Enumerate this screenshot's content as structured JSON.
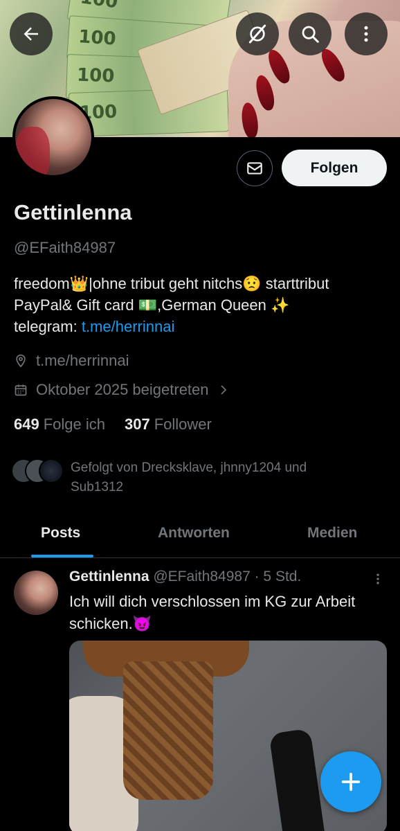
{
  "banner": {
    "note_denomination": "100"
  },
  "profile": {
    "name": "Gettinlenna",
    "handle": "@EFaith84987",
    "follow_label": "Folgen",
    "bio_line1": "freedom👑|ohne tribut geht nitchs😟 starttribut",
    "bio_line2": "PayPal& Gift card 💵,German Queen ✨",
    "bio_line3_prefix": "telegram: ",
    "bio_link": "t.me/herrinnai",
    "location": "t.me/herrinnai",
    "joined": "Oktober 2025 beigetreten",
    "following_count": "649",
    "following_label": "Folge ich",
    "followers_count": "307",
    "followers_label": "Follower",
    "followed_by": "Gefolgt von Drecksklave, jhnny1204 und Sub1312"
  },
  "tabs": [
    {
      "label": "Posts"
    },
    {
      "label": "Antworten"
    },
    {
      "label": "Medien"
    }
  ],
  "post": {
    "author": "Gettinlenna",
    "handle_time": "@EFaith84987 · 5 Std.",
    "text": "Ich will dich verschlossen im KG zur Arbeit schicken.😈"
  },
  "colors": {
    "accent": "#1d9bf0",
    "background": "#000000",
    "secondary_text": "#71767b"
  },
  "icons": [
    "back-arrow-icon",
    "grok-icon",
    "search-icon",
    "more-vertical-icon",
    "mail-icon",
    "location-icon",
    "calendar-icon",
    "chevron-right-icon",
    "plus-icon"
  ]
}
